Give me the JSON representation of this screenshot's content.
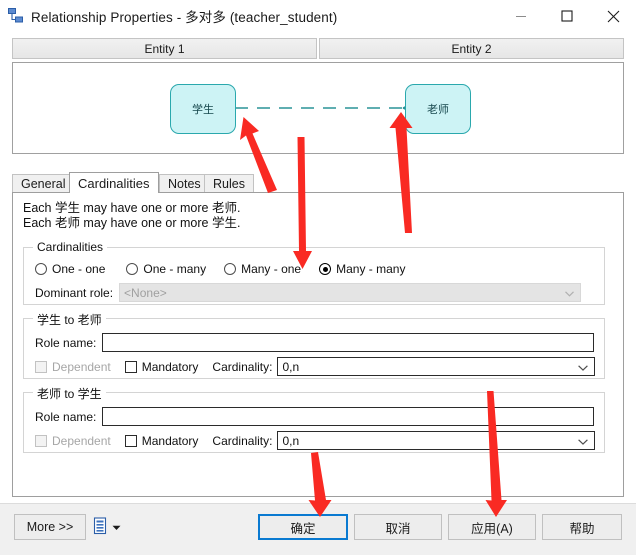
{
  "window": {
    "title": "Relationship Properties - 多对多 (teacher_student)",
    "app_icon": "relationship-icon",
    "minimize": "minimize-icon",
    "maximize": "maximize-icon",
    "close": "close-icon"
  },
  "entity_tabs": [
    {
      "label": "Entity 1"
    },
    {
      "label": "Entity 2"
    }
  ],
  "diagram": {
    "left_entity": "学生",
    "right_entity": "老师",
    "link_style": "dashed",
    "left_connector": "crowsfoot",
    "right_connector": "crowsfoot",
    "entity_fill": "#cdf3f5",
    "entity_border": "#2aa8ad",
    "link_color": "#2a9397"
  },
  "tabs": [
    {
      "label": "General",
      "active": false
    },
    {
      "label": "Cardinalities",
      "active": true
    },
    {
      "label": "Notes",
      "active": false
    },
    {
      "label": "Rules",
      "active": false
    }
  ],
  "description": {
    "line1": "Each 学生 may have one or more 老师.",
    "line2": "Each 老师 may have one or more 学生."
  },
  "cardinalities": {
    "legend": "Cardinalities",
    "options": [
      {
        "label": "One - one",
        "selected": false
      },
      {
        "label": "One - many",
        "selected": false
      },
      {
        "label": "Many - one",
        "selected": false
      },
      {
        "label": "Many - many",
        "selected": true
      }
    ],
    "dominant_role_label": "Dominant role:",
    "dominant_role_value": "<None>",
    "dominant_role_disabled": true
  },
  "role_student_to_teacher": {
    "legend": "学生 to 老师",
    "role_name_label": "Role name:",
    "role_name_value": "",
    "dependent_label": "Dependent",
    "dependent_checked": false,
    "dependent_disabled": true,
    "mandatory_label": "Mandatory",
    "mandatory_checked": false,
    "cardinality_label": "Cardinality:",
    "cardinality_value": "0,n"
  },
  "role_teacher_to_student": {
    "legend": "老师 to 学生",
    "role_name_label": "Role name:",
    "role_name_value": "",
    "dependent_label": "Dependent",
    "dependent_checked": false,
    "dependent_disabled": true,
    "mandatory_label": "Mandatory",
    "mandatory_checked": false,
    "cardinality_label": "Cardinality:",
    "cardinality_value": "0,n"
  },
  "footer": {
    "more_label": "More >>",
    "print_icon": "print-document-icon",
    "print_caret": "chevron-down-icon",
    "ok_label": "确定",
    "cancel_label": "取消",
    "apply_label": "应用(A)",
    "help_label": "帮助",
    "focused_button": "确定"
  },
  "annotations": {
    "color": "#f92a23",
    "arrows": [
      {
        "name": "arrow-left-entity-connector",
        "target": "学生 crow's foot connector"
      },
      {
        "name": "arrow-right-entity-connector",
        "target": "老师 crow's foot connector"
      },
      {
        "name": "arrow-many-many-radio",
        "target": "Many - many radio"
      },
      {
        "name": "arrow-ok-button",
        "target": "确定 button"
      },
      {
        "name": "arrow-apply-button",
        "target": "应用(A) button"
      }
    ]
  }
}
